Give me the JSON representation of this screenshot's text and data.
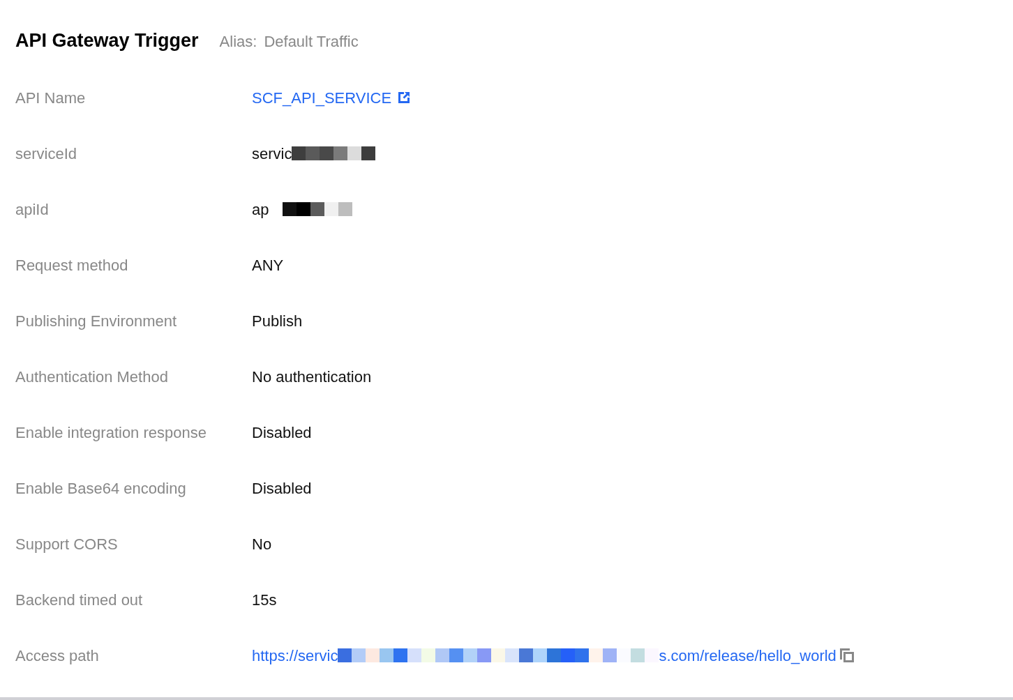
{
  "header": {
    "title": "API Gateway Trigger",
    "alias_label": "Alias:",
    "alias_value": "Default Traffic"
  },
  "rows": [
    {
      "label": "API Name",
      "kind": "link",
      "value": "SCF_API_SERVICE",
      "external": true
    },
    {
      "label": "serviceId",
      "kind": "text",
      "value": "servic",
      "redacted": true
    },
    {
      "label": "apiId",
      "kind": "text",
      "value": "ap",
      "redacted": true
    },
    {
      "label": "Request method",
      "kind": "text",
      "value": "ANY"
    },
    {
      "label": "Publishing Environment",
      "kind": "text",
      "value": "Publish"
    },
    {
      "label": "Authentication Method",
      "kind": "text",
      "value": "No authentication"
    },
    {
      "label": "Enable integration response",
      "kind": "text",
      "value": "Disabled"
    },
    {
      "label": "Enable Base64 encoding",
      "kind": "text",
      "value": "Disabled"
    },
    {
      "label": "Support CORS",
      "kind": "text",
      "value": "No"
    },
    {
      "label": "Backend timed out",
      "kind": "text",
      "value": "15s"
    },
    {
      "label": "Access path",
      "kind": "link",
      "value": "https://servic",
      "redacted": true,
      "value_end": "s.com/release/hello_world",
      "copyable": true
    }
  ]
}
